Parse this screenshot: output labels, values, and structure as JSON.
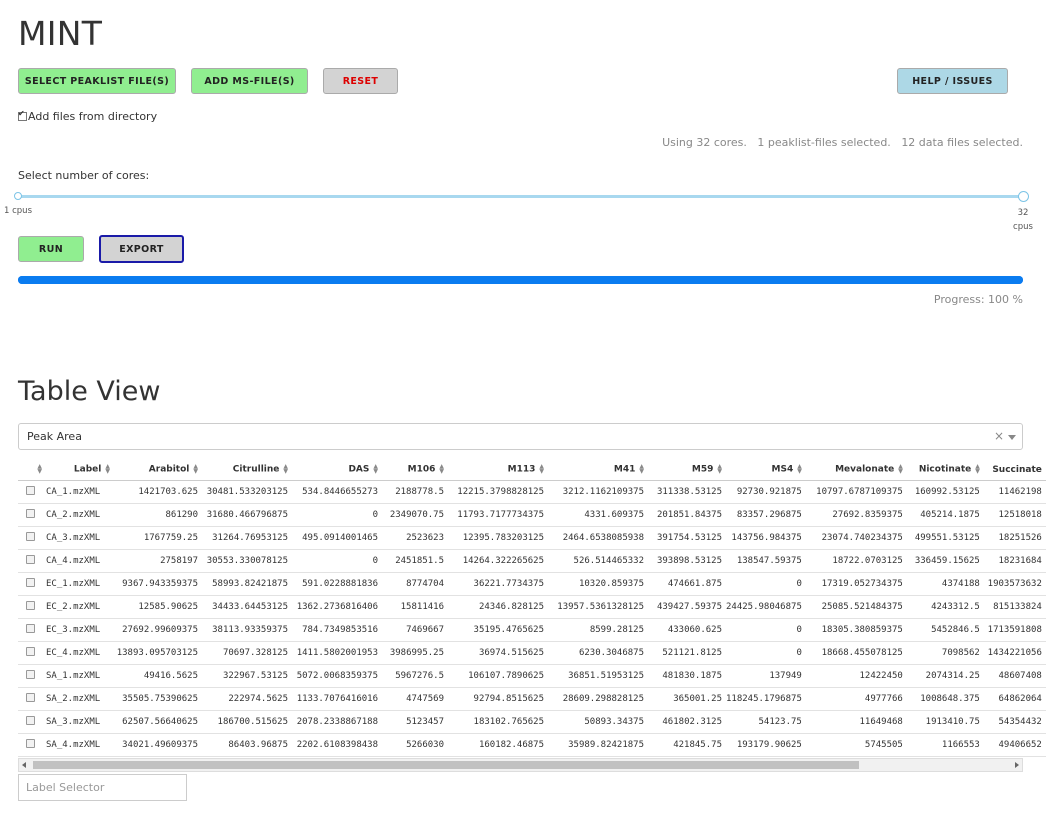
{
  "app": {
    "title": "MINT"
  },
  "buttons": {
    "select_peaklist": "SELECT PEAKLIST FILE(S)",
    "add_ms": "ADD MS-FILE(S)",
    "reset": "RESET",
    "help": "HELP / ISSUES",
    "run": "RUN",
    "export": "EXPORT"
  },
  "directory_checkbox": {
    "label": "Add files from directory",
    "checked": true
  },
  "status": {
    "cores": "Using 32 cores.",
    "peaklists": "1 peaklist-files selected.",
    "datafiles": "12 data files selected."
  },
  "cores_slider": {
    "label": "Select number of cores:",
    "min_label": "1 cpus",
    "max_label_num": "32",
    "max_label_unit": "cpus",
    "min": 1,
    "max": 32,
    "value": 32
  },
  "progress": {
    "value_pct": 100,
    "text": "Progress: 100 %"
  },
  "table_view": {
    "title": "Table View",
    "metric_selected": "Peak Area",
    "clear_symbol": "×",
    "columns": [
      "Label",
      "Arabitol",
      "Citrulline",
      "DAS",
      "M106",
      "M113",
      "M41",
      "M59",
      "MS4",
      "Mevalonate",
      "Nicotinate",
      "Succinate"
    ],
    "rows": [
      [
        "CA_1.mzXML",
        "1421703.625",
        "30481.533203125",
        "534.8446655273",
        "2188778.5",
        "12215.3798828125",
        "3212.1162109375",
        "311338.53125",
        "92730.921875",
        "10797.6787109375",
        "160992.53125",
        "11462198"
      ],
      [
        "CA_2.mzXML",
        "861290",
        "31680.466796875",
        "0",
        "2349070.75",
        "11793.7177734375",
        "4331.609375",
        "201851.84375",
        "83357.296875",
        "27692.8359375",
        "405214.1875",
        "12518018"
      ],
      [
        "CA_3.mzXML",
        "1767759.25",
        "31264.76953125",
        "495.0914001465",
        "2523623",
        "12395.783203125",
        "2464.6538085938",
        "391754.53125",
        "143756.984375",
        "23074.740234375",
        "499551.53125",
        "18251526"
      ],
      [
        "CA_4.mzXML",
        "2758197",
        "30553.330078125",
        "0",
        "2451851.5",
        "14264.322265625",
        "526.514465332",
        "393898.53125",
        "138547.59375",
        "18722.0703125",
        "336459.15625",
        "18231684"
      ],
      [
        "EC_1.mzXML",
        "9367.943359375",
        "58993.82421875",
        "591.0228881836",
        "8774704",
        "36221.7734375",
        "10320.859375",
        "474661.875",
        "0",
        "17319.052734375",
        "4374188",
        "1903573632"
      ],
      [
        "EC_2.mzXML",
        "12585.90625",
        "34433.64453125",
        "1362.2736816406",
        "15811416",
        "24346.828125",
        "13957.5361328125",
        "439427.59375",
        "24425.98046875",
        "25085.521484375",
        "4243312.5",
        "815133824"
      ],
      [
        "EC_3.mzXML",
        "27692.99609375",
        "38113.93359375",
        "784.7349853516",
        "7469667",
        "35195.4765625",
        "8599.28125",
        "433060.625",
        "0",
        "18305.380859375",
        "5452846.5",
        "1713591808"
      ],
      [
        "EC_4.mzXML",
        "13893.095703125",
        "70697.328125",
        "1411.5802001953",
        "3986995.25",
        "36974.515625",
        "6230.3046875",
        "521121.8125",
        "0",
        "18668.455078125",
        "7098562",
        "1434221056"
      ],
      [
        "SA_1.mzXML",
        "49416.5625",
        "322967.53125",
        "5072.0068359375",
        "5967276.5",
        "106107.7890625",
        "36851.51953125",
        "481830.1875",
        "137949",
        "12422450",
        "2074314.25",
        "48607408"
      ],
      [
        "SA_2.mzXML",
        "35505.75390625",
        "222974.5625",
        "1133.7076416016",
        "4747569",
        "92794.8515625",
        "28609.298828125",
        "365001.25",
        "118245.1796875",
        "4977766",
        "1008648.375",
        "64862064"
      ],
      [
        "SA_3.mzXML",
        "62507.56640625",
        "186700.515625",
        "2078.2338867188",
        "5123457",
        "183102.765625",
        "50893.34375",
        "461802.3125",
        "54123.75",
        "11649468",
        "1913410.75",
        "54354432"
      ],
      [
        "SA_4.mzXML",
        "34021.49609375",
        "86403.96875",
        "2202.6108398438",
        "5266030",
        "160182.46875",
        "35989.82421875",
        "421845.75",
        "193179.90625",
        "5745505",
        "1166553",
        "49406652"
      ]
    ]
  },
  "label_selector": {
    "placeholder": "Label Selector"
  },
  "colors": {
    "green_button": "#90ee90",
    "help_button": "#add8e6",
    "progress": "#0a7cf0",
    "reset_text": "#dd0000"
  }
}
